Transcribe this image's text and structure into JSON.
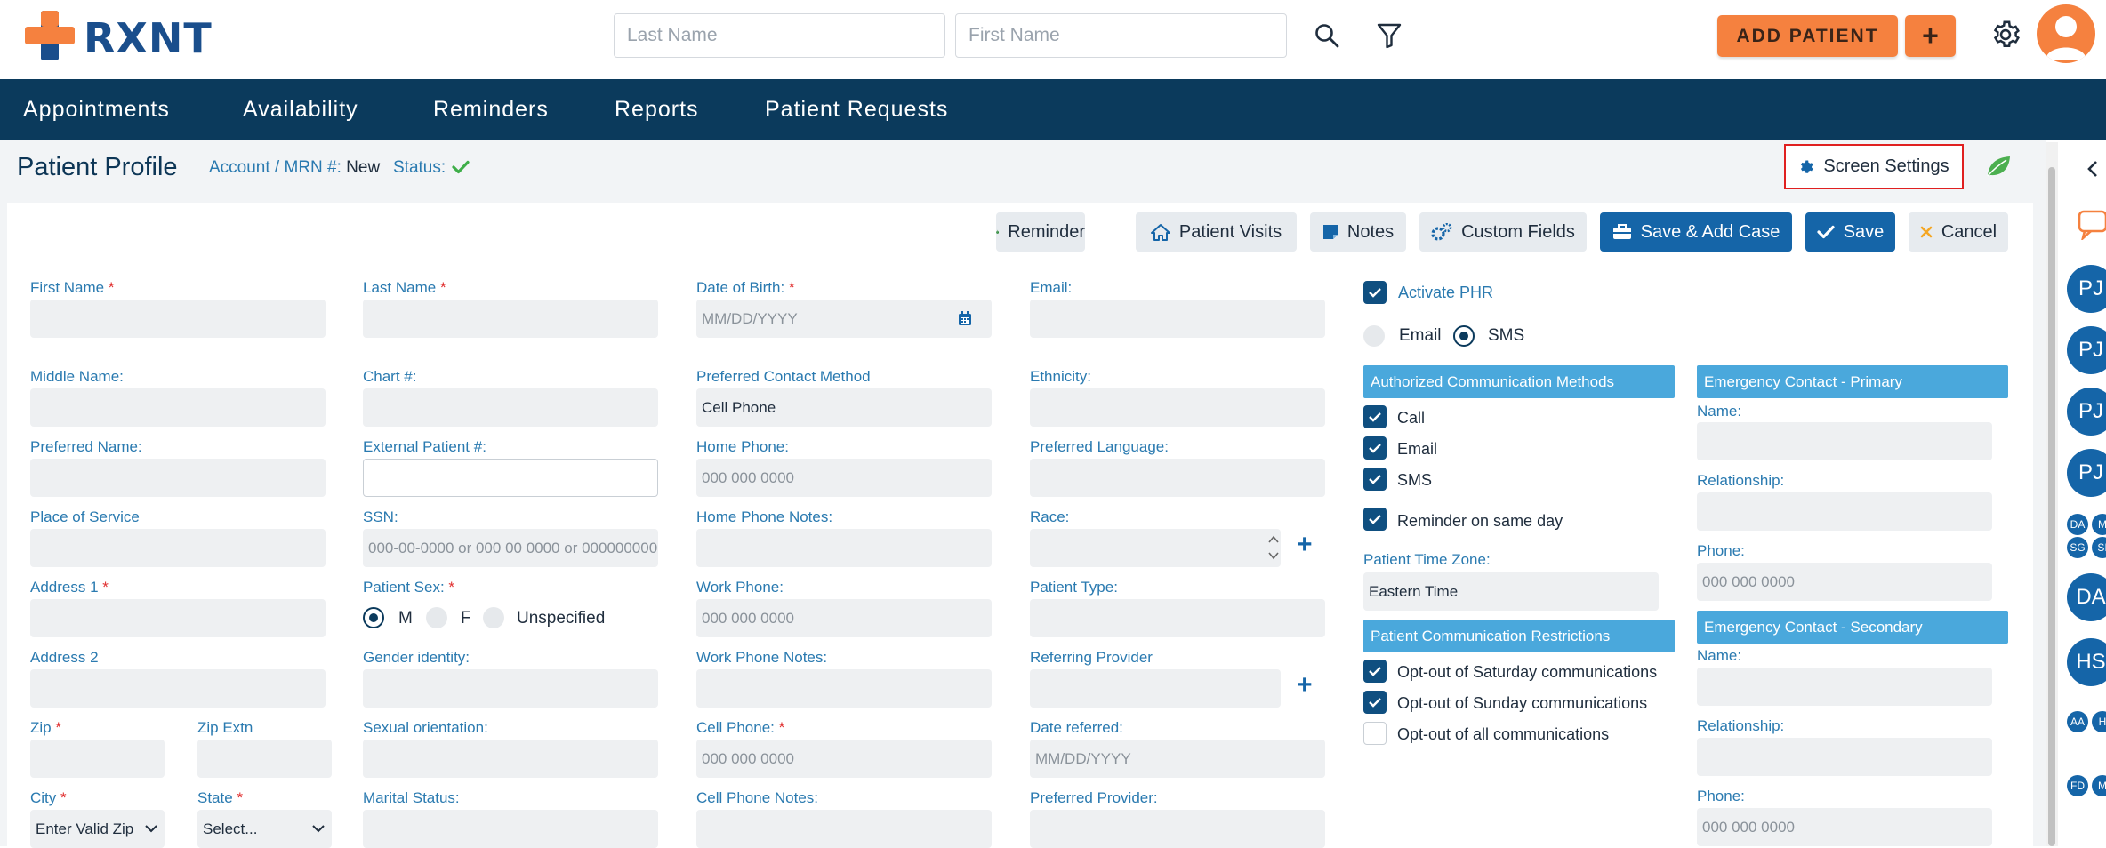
{
  "header": {
    "logo_text": "RXNT",
    "last_name_placeholder": "Last Name",
    "first_name_placeholder": "First Name",
    "add_patient_label": "ADD PATIENT",
    "add_plus_label": "+"
  },
  "nav": [
    "Appointments",
    "Availability",
    "Reminders",
    "Reports",
    "Patient Requests"
  ],
  "page": {
    "title": "Patient Profile",
    "account_label": "Account / MRN #:",
    "account_value": "New",
    "status_label": "Status:",
    "screen_settings": "Screen Settings"
  },
  "toolbar": {
    "reminder": "Reminder",
    "patient_visits": "Patient Visits",
    "notes": "Notes",
    "custom_fields": "Custom Fields",
    "save_add_case": "Save & Add Case",
    "save": "Save",
    "cancel": "Cancel"
  },
  "form": {
    "first_name": "First Name",
    "last_name": "Last Name",
    "dob": "Date of Birth:",
    "dob_placeholder": "MM/DD/YYYY",
    "email": "Email:",
    "middle_name": "Middle Name:",
    "chart": "Chart #:",
    "preferred_contact": "Preferred Contact Method",
    "preferred_contact_value": "Cell Phone",
    "ethnicity": "Ethnicity:",
    "preferred_name": "Preferred Name:",
    "external_patient": "External Patient #:",
    "home_phone": "Home Phone:",
    "phone_placeholder": "000 000 0000",
    "preferred_language": "Preferred Language:",
    "place_of_service": "Place of Service",
    "ssn": "SSN:",
    "ssn_placeholder": "000-00-0000 or 000 00 0000 or 000000000",
    "home_phone_notes": "Home Phone Notes:",
    "race": "Race:",
    "address1": "Address 1",
    "patient_sex": "Patient Sex:",
    "sex_m": "M",
    "sex_f": "F",
    "sex_u": "Unspecified",
    "work_phone": "Work Phone:",
    "patient_type": "Patient Type:",
    "address2": "Address 2",
    "gender_identity": "Gender identity:",
    "work_phone_notes": "Work Phone Notes:",
    "referring_provider": "Referring Provider",
    "zip": "Zip",
    "zip_extn": "Zip Extn",
    "sexual_orientation": "Sexual orientation:",
    "cell_phone": "Cell Phone:",
    "date_referred": "Date referred:",
    "city": "City",
    "city_value": "Enter Valid Zip",
    "state": "State",
    "state_value": "Select...",
    "marital_status": "Marital Status:",
    "cell_phone_notes": "Cell Phone Notes:",
    "preferred_provider": "Preferred Provider:"
  },
  "comm": {
    "activate_phr": "Activate PHR",
    "email": "Email",
    "sms": "SMS",
    "auth_header": "Authorized Communication Methods",
    "call": "Call",
    "auth_email": "Email",
    "auth_sms": "SMS",
    "reminder_same_day": "Reminder on same day",
    "timezone_label": "Patient Time Zone:",
    "timezone_value": "Eastern Time",
    "restrictions_header": "Patient Communication Restrictions",
    "optout_sat": "Opt-out of Saturday communications",
    "optout_sun": "Opt-out of Sunday communications",
    "optout_all": "Opt-out of all communications"
  },
  "emergency": {
    "primary_header": "Emergency Contact - Primary",
    "secondary_header": "Emergency Contact - Secondary",
    "name": "Name:",
    "relationship": "Relationship:",
    "phone": "Phone:",
    "phone_placeholder": "000 000 0000"
  },
  "rail": {
    "avatars": [
      "PJ",
      "PJ",
      "PJ",
      "PJ",
      "DA",
      "HS"
    ],
    "mini": [
      "DA",
      "M",
      "SG",
      "SI",
      "AA",
      "H",
      "FD",
      "M"
    ]
  },
  "colors": {
    "brand": "#1a4e8c",
    "accent_orange": "#f5813f",
    "nav_bg": "#0b3a5c",
    "primary_blue": "#1565a8",
    "section_header": "#4aa8dc",
    "required": "#e02d2d"
  }
}
